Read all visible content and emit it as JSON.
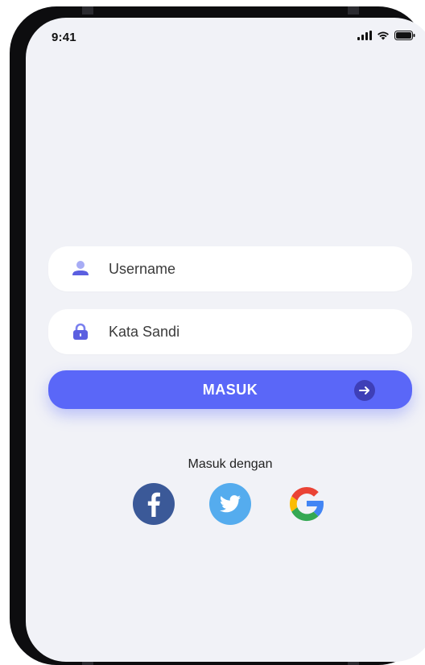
{
  "status_bar": {
    "time": "9:41",
    "icons": [
      "signal-icon",
      "wifi-icon",
      "battery-icon"
    ]
  },
  "login_form": {
    "username": {
      "placeholder": "Username",
      "value": "",
      "icon": "user-icon"
    },
    "password": {
      "placeholder": "Kata Sandi",
      "value": "",
      "icon": "lock-icon"
    },
    "submit": {
      "label": "MASUK",
      "icon": "arrow-right-icon"
    }
  },
  "social_login": {
    "label": "Masuk dengan",
    "providers": [
      {
        "name": "Facebook",
        "icon": "facebook-icon",
        "color": "#3b5998"
      },
      {
        "name": "Twitter",
        "icon": "twitter-icon",
        "color": "#55acee"
      },
      {
        "name": "Google",
        "icon": "google-icon",
        "color": "#4285f4"
      }
    ]
  },
  "colors": {
    "accent": "#5a67f8",
    "accent_dark": "#3e3fb7",
    "icon_purple": "#5b5fe0",
    "screen_bg": "#f1f2f7",
    "field_bg": "#ffffff"
  }
}
